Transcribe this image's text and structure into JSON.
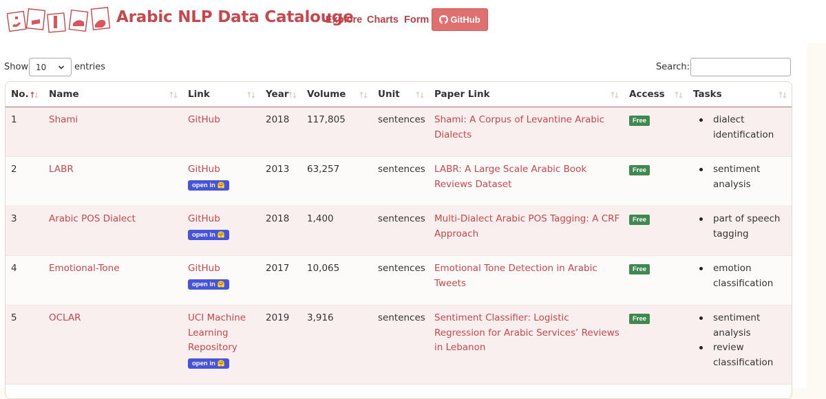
{
  "header": {
    "logo_text": "مصادر",
    "title": "Arabic NLP Data Catalouge",
    "nav": {
      "explore": "Explore",
      "charts": "Charts",
      "form": "Form"
    },
    "github_button": "GitHub",
    "github_icon": "github-icon"
  },
  "controls": {
    "show_label": "Show",
    "entries_value": "10",
    "entries_label": "entries",
    "search_label": "Search:",
    "search_value": ""
  },
  "table": {
    "columns": [
      "No.",
      "Name",
      "Link",
      "Year",
      "Volume",
      "Unit",
      "Paper Link",
      "Access",
      "Tasks"
    ],
    "open_in_label": "open in",
    "rows": [
      {
        "no": "1",
        "name": "Shami",
        "link": "GitHub",
        "open_in": false,
        "year": "2018",
        "volume": "117,805",
        "unit": "sentences",
        "paper": "Shami: A Corpus of Levantine Arabic Dialects",
        "access": "Free",
        "tasks": [
          "dialect identification"
        ]
      },
      {
        "no": "2",
        "name": "LABR",
        "link": "GitHub",
        "open_in": true,
        "year": "2013",
        "volume": "63,257",
        "unit": "sentences",
        "paper": "LABR: A Large Scale Arabic Book Reviews Dataset",
        "access": "Free",
        "tasks": [
          "sentiment analysis"
        ]
      },
      {
        "no": "3",
        "name": "Arabic POS Dialect",
        "link": "GitHub",
        "open_in": true,
        "year": "2018",
        "volume": "1,400",
        "unit": "sentences",
        "paper": "Multi-Dialect Arabic POS Tagging: A CRF Approach",
        "access": "Free",
        "tasks": [
          "part of speech tagging"
        ]
      },
      {
        "no": "4",
        "name": "Emotional-Tone",
        "link": "GitHub",
        "open_in": true,
        "year": "2017",
        "volume": "10,065",
        "unit": "sentences",
        "paper": "Emotional Tone Detection in Arabic Tweets",
        "access": "Free",
        "tasks": [
          "emotion classification"
        ]
      },
      {
        "no": "5",
        "name": "OCLAR",
        "link": "UCI Machine Learning Repository",
        "open_in": true,
        "year": "2019",
        "volume": "3,916",
        "unit": "sentences",
        "paper": "Sentiment Classifier: Logistic Regression for Arabic Services’ Reviews in Lebanon",
        "access": "Free",
        "tasks": [
          "sentiment analysis",
          "review classification"
        ]
      }
    ]
  },
  "colors": {
    "brand": "#c8474d",
    "github_button": "#e07070",
    "free_badge": "#3f8850",
    "open_in_badge": "#4553dd",
    "odd_row": "#f9efee"
  }
}
